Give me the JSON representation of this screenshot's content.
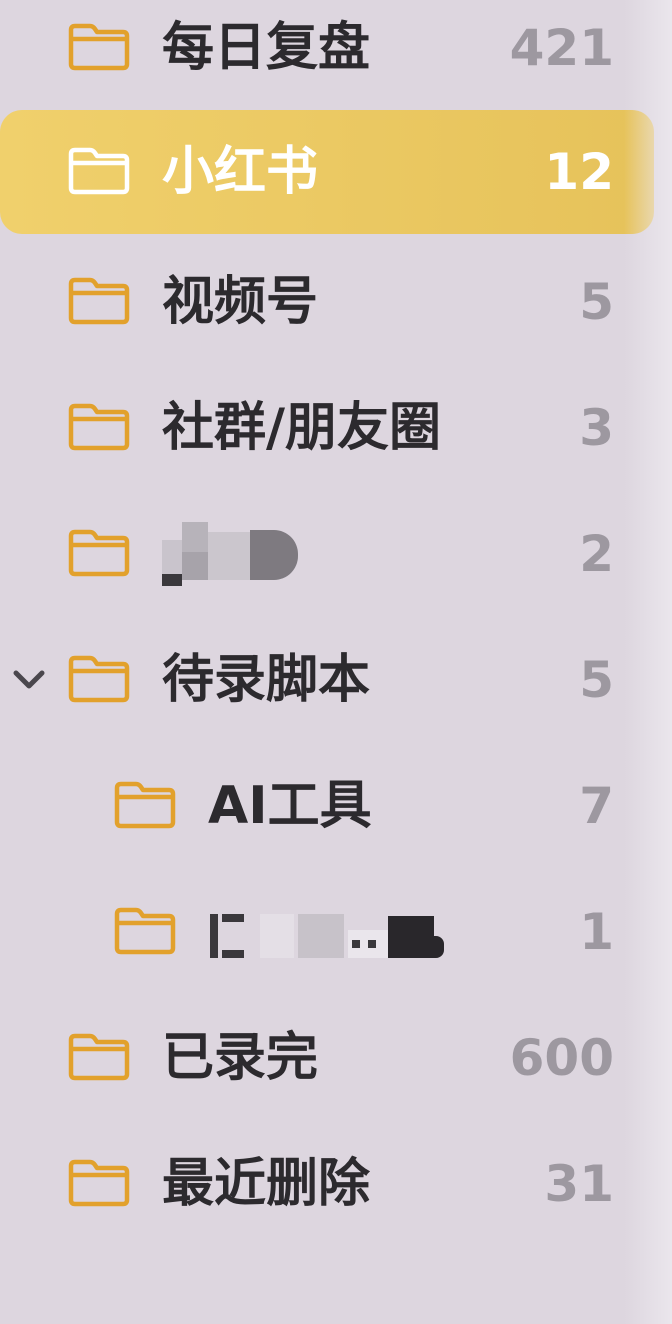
{
  "colors": {
    "background": "#ddd6df",
    "folder_icon": "#e2a12c",
    "selected_row": "#e9c661",
    "label_text": "#2c2a2e",
    "count_text": "#9d98a0",
    "selected_text": "#ffffff"
  },
  "folders": [
    {
      "icon": "folder-icon",
      "label": "每日复盘",
      "count": "421"
    },
    {
      "icon": "folder-icon",
      "label": "小红书",
      "count": "12",
      "selected": true
    },
    {
      "icon": "folder-icon",
      "label": "视频号",
      "count": "5"
    },
    {
      "icon": "folder-icon",
      "label": "社群/朋友圈",
      "count": "3"
    },
    {
      "icon": "folder-icon",
      "label": "",
      "count": "2",
      "redacted": true
    },
    {
      "icon": "folder-icon",
      "label": "待录脚本",
      "count": "5",
      "expanded": true,
      "disclosure_icon": "chevron-down-icon",
      "children": [
        {
          "icon": "folder-icon",
          "label": "AI工具",
          "count": "7"
        },
        {
          "icon": "folder-icon",
          "label": "",
          "count": "1",
          "redacted": true
        }
      ]
    },
    {
      "icon": "folder-icon",
      "label": "已录完",
      "count": "600"
    },
    {
      "icon": "folder-icon",
      "label": "最近删除",
      "count": "31"
    }
  ]
}
